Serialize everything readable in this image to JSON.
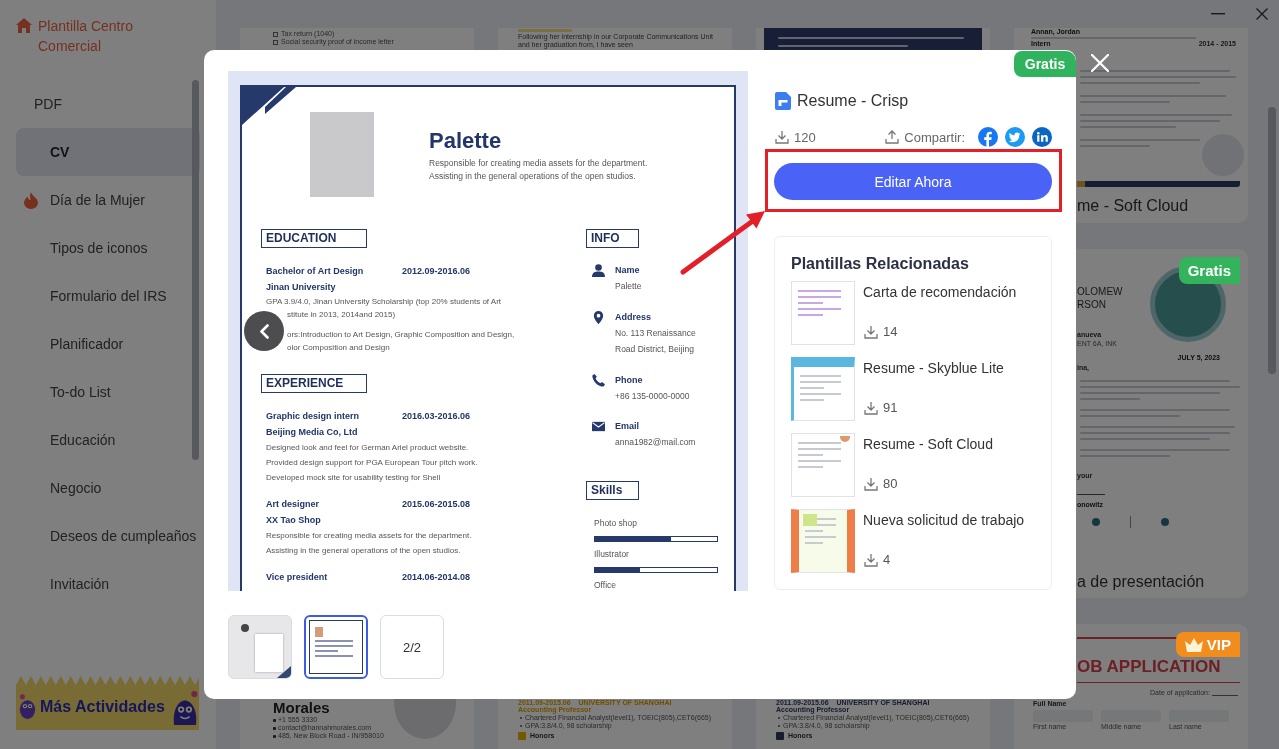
{
  "sidebar": {
    "brand": "Plantilla Centro Comercial",
    "items": [
      {
        "label": "PDF",
        "kind": "group",
        "selected": false,
        "hot": false
      },
      {
        "label": "CV",
        "kind": "item",
        "selected": true,
        "hot": false
      },
      {
        "label": "Día de la Mujer",
        "kind": "item",
        "selected": false,
        "hot": true
      },
      {
        "label": "Tipos de iconos",
        "kind": "item",
        "selected": false,
        "hot": false
      },
      {
        "label": "Formulario del IRS",
        "kind": "item",
        "selected": false,
        "hot": false
      },
      {
        "label": "Planificador",
        "kind": "item",
        "selected": false,
        "hot": false
      },
      {
        "label": "To-do List",
        "kind": "item",
        "selected": false,
        "hot": false
      },
      {
        "label": "Educación",
        "kind": "item",
        "selected": false,
        "hot": false
      },
      {
        "label": "Negocio",
        "kind": "item",
        "selected": false,
        "hot": false
      },
      {
        "label": "Deseos de cumpleaños",
        "kind": "item",
        "selected": false,
        "hot": false
      },
      {
        "label": "Invitación",
        "kind": "item",
        "selected": false,
        "hot": false
      }
    ],
    "promo": "Más Actividades"
  },
  "gallery": {
    "columns": [
      {
        "cards": [
          {
            "kind": "checklist",
            "items": [
              {
                "text": "Tax return (1040)",
                "checked": false
              },
              {
                "text": "Social security proof of income letter",
                "checked": false
              }
            ]
          },
          {
            "kind": "profile",
            "name": "Morales",
            "contacts": [
              "+1 555 3330",
              "contact@hannahmorales.com",
              "485, New Block Road - IN/958010"
            ]
          }
        ]
      },
      {
        "cards": [
          {
            "kind": "letter",
            "lines": [
              "Following her internship in our Corporate Communications Unit and her graduation from, I have seen"
            ]
          },
          {
            "kind": "education",
            "highlighted": true,
            "row": [
              "2011.09-2015.06",
              "UNIVERSITY OF SHANGHAI",
              "Accounting Professor"
            ],
            "bullets": [
              "Chartered Financial Analyst(level1), TOEIC(805),CET6(665)",
              "GPA:3.8/4.0, 98 scholarship"
            ],
            "section": "Honors"
          }
        ]
      },
      {
        "cards": [
          {
            "kind": "bullets"
          },
          {
            "kind": "education",
            "highlighted": false,
            "row": [
              "2011.09-2015.06",
              "UNIVERSITY OF SHANGHAI",
              "Accounting Professor"
            ],
            "bullets": [
              "Chartered Financial Analyst(level1), TOEIC(805),CET6(665)",
              "GPA:3.8/4.0, 98 scholarship"
            ],
            "section": "Honors"
          }
        ]
      },
      {
        "cards": [
          {
            "kind": "resume",
            "name": "Annan, Jordan",
            "role": "Intern",
            "date": "2014 - 2015",
            "caption": "me - Soft Cloud"
          },
          {
            "kind": "cover",
            "badge": {
              "label": "Gratis",
              "kind": "free"
            },
            "name_lines": [
              "OLOMEW",
              "RSON"
            ],
            "street": "anueva",
            "address": "ENT 6A, INK",
            "date": "JULY 5, 2023",
            "greeting": "ina,",
            "closing": "your",
            "signature": "onowitz",
            "caption": "a de presentación"
          },
          {
            "kind": "application",
            "badge": {
              "label": "VIP",
              "kind": "vip"
            },
            "heading": "OB APPLICATION",
            "date_label": "Date of application:",
            "field_label": "Full Name",
            "subfields": [
              "First name",
              "Middle name",
              "Last name"
            ]
          }
        ]
      }
    ]
  },
  "modal": {
    "badge": "Gratis",
    "preview": {
      "resume": {
        "name": "Palette",
        "summary": [
          "Responsible for creating media assets for the department.",
          "Assisting in the general operations of the open studios."
        ],
        "education": {
          "heading": "EDUCATION",
          "entries": [
            {
              "title": "Bachelor of Art Design",
              "date": "2012.09-2016.06",
              "org": "Jinan University",
              "paragraphs": [
                [
                  "GPA 3.9/4.0,  Jinan University Scholarship (top 20% students of Art",
                  "stitute in 2013,  2014and  2015)"
                ],
                [
                  "ors:Introduction to Art Design, Graphic Composition and Design,",
                  "olor Composition and Design"
                ]
              ]
            }
          ]
        },
        "experience": {
          "heading": "EXPERIENCE",
          "entries": [
            {
              "title": "Graphic design intern",
              "date": "2016.03-2016.06",
              "org": "Beijing Media Co, Ltd",
              "paragraphs": [
                [
                  "Designed look and feel for German Ariel product website."
                ],
                [
                  "Provided design support for PGA European Tour pitch work."
                ],
                [
                  "Developed mock site for usability testing for Shell"
                ]
              ]
            },
            {
              "title": "Art designer",
              "date": "2015.06-2015.08",
              "org": "XX Tao Shop",
              "paragraphs": [
                [
                  "Responsible for creating media assets for the department."
                ],
                [
                  "Assisting in the general operations of the open studios."
                ]
              ]
            },
            {
              "title": "Vice president",
              "date": "2014.06-2014.08"
            }
          ]
        },
        "info": {
          "heading": "INFO",
          "entries": [
            {
              "kind": "person",
              "label": "Name",
              "lines": [
                "Palette"
              ]
            },
            {
              "kind": "location",
              "label": "Address",
              "lines": [
                "No. 113 Renaissance",
                "Road District, Beijing"
              ]
            },
            {
              "kind": "phone",
              "label": "Phone",
              "lines": [
                "+86 135-0000-0000"
              ]
            },
            {
              "kind": "email",
              "label": "Email",
              "lines": [
                "anna1982@mail.com"
              ]
            }
          ]
        },
        "skills": {
          "heading": "Skills",
          "items": [
            {
              "name": "Photo shop",
              "level": 0.62
            },
            {
              "name": "Illustrator",
              "level": 0.37
            },
            {
              "name": "Office"
            }
          ]
        }
      },
      "pages": [
        {
          "kind": "mockup",
          "selected": false
        },
        {
          "kind": "document",
          "selected": true
        }
      ],
      "page_indicator": "2/2"
    },
    "detail": {
      "title": "Resume - Crisp",
      "downloads": "120",
      "share_label": "Compartir:",
      "cta": "Editar Ahora",
      "related": {
        "title": "Plantillas Relacionadas",
        "items": [
          {
            "name": "Carta de recomendación",
            "downloads": "14"
          },
          {
            "name": "Resume - Skyblue Lite",
            "downloads": "91"
          },
          {
            "name": "Resume - Soft Cloud",
            "downloads": "80"
          },
          {
            "name": "Nueva solicitud de trabajo",
            "downloads": "4"
          }
        ]
      }
    }
  }
}
